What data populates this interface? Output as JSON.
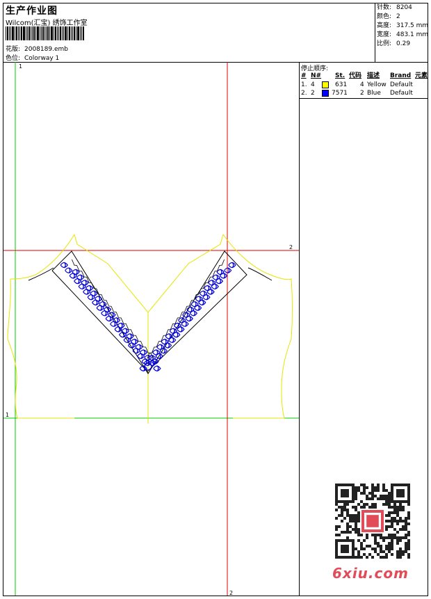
{
  "header": {
    "title": "生产作业图",
    "company": "Wilcom(汇宝) 绣饰工作室",
    "design_label": "花版:",
    "design_value": "2008189.emb",
    "colorway_label": "色位:",
    "colorway_value": "Colorway 1"
  },
  "stats": [
    {
      "label": "针数:",
      "value": "8204"
    },
    {
      "label": "颜色:",
      "value": "2"
    },
    {
      "label": "高度:",
      "value": "317.5 mm"
    },
    {
      "label": "宽度:",
      "value": "483.1 mm"
    },
    {
      "label": "比例:",
      "value": "0.29"
    }
  ],
  "stop_sequence": {
    "title": "停止顺序:",
    "headers": [
      "#",
      "N#",
      "St.",
      "代码",
      "描述",
      "Brand",
      "元素"
    ],
    "rows": [
      {
        "num": "1.",
        "n": "4",
        "stitches": "631",
        "code": "4",
        "desc": "Yellow",
        "brand": "Default",
        "color": "#ffff00"
      },
      {
        "num": "2.",
        "n": "2",
        "stitches": "7571",
        "code": "2",
        "desc": "Blue",
        "brand": "Default",
        "color": "#0000ff"
      }
    ]
  },
  "guides": {
    "green_top": "1",
    "green_left": "1",
    "red_right": "2",
    "red_bottom": "2"
  },
  "watermark": {
    "brand": "6xiu.com"
  },
  "colors": {
    "guide_green": "#00cc00",
    "guide_red": "#dd0000",
    "outline_yellow": "#e6e600",
    "embroidery_blue": "#0000dd"
  }
}
